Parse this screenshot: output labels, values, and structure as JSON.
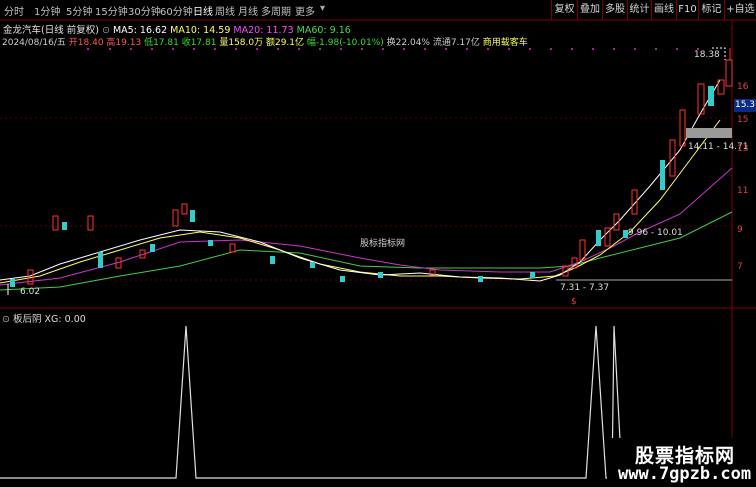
{
  "toolbar": {
    "tabs": [
      "分时",
      "1分钟",
      "5分钟",
      "15分钟",
      "30分钟",
      "60分钟",
      "日线",
      "周线",
      "月线",
      "多周期",
      "更多"
    ],
    "active_tab": "日线",
    "right_buttons": [
      "复权",
      "叠加",
      "多股",
      "统计",
      "画线",
      "F10",
      "标记",
      "+自选"
    ]
  },
  "header": {
    "title": "金龙汽车(日线 前复权)",
    "ma": [
      {
        "label": "MA5: 16.62",
        "color": "#ffffff"
      },
      {
        "label": "MA10: 14.59",
        "color": "#ffff55"
      },
      {
        "label": "MA20: 11.73",
        "color": "#ff44ff"
      },
      {
        "label": "MA60: 9.16",
        "color": "#44dd44"
      }
    ],
    "line2": {
      "date": "2024/08/16/五",
      "open": "开18.40",
      "high": "高19.13",
      "low": "低17.81",
      "close": "收17.81",
      "volume": "量158.0万",
      "amount": "额29.1亿",
      "change": "幅-1.98(-10.01%)",
      "turnover": "换22.04%",
      "float": "流通7.17亿",
      "sector": "商用载客车"
    }
  },
  "price_axis": [
    "16",
    "15",
    "13",
    "11",
    "9",
    "7"
  ],
  "price_badge": "15.3",
  "annotations": {
    "high_label": "18.38",
    "low_label": "6.02",
    "range1": "14.11 - 14.71",
    "range2": "9.96 - 10.01",
    "range3": "7.31 - 7.37",
    "signal": "$"
  },
  "watermark": "股标指标网",
  "indicator": {
    "name": "板后阴",
    "line": "XG: 0.00"
  },
  "logo": {
    "line1": "股票指标网",
    "line2": "www.7gpzb.com"
  },
  "colors": {
    "up": "#ff3333",
    "down": "#33cccc",
    "grid": "#7a0000"
  }
}
